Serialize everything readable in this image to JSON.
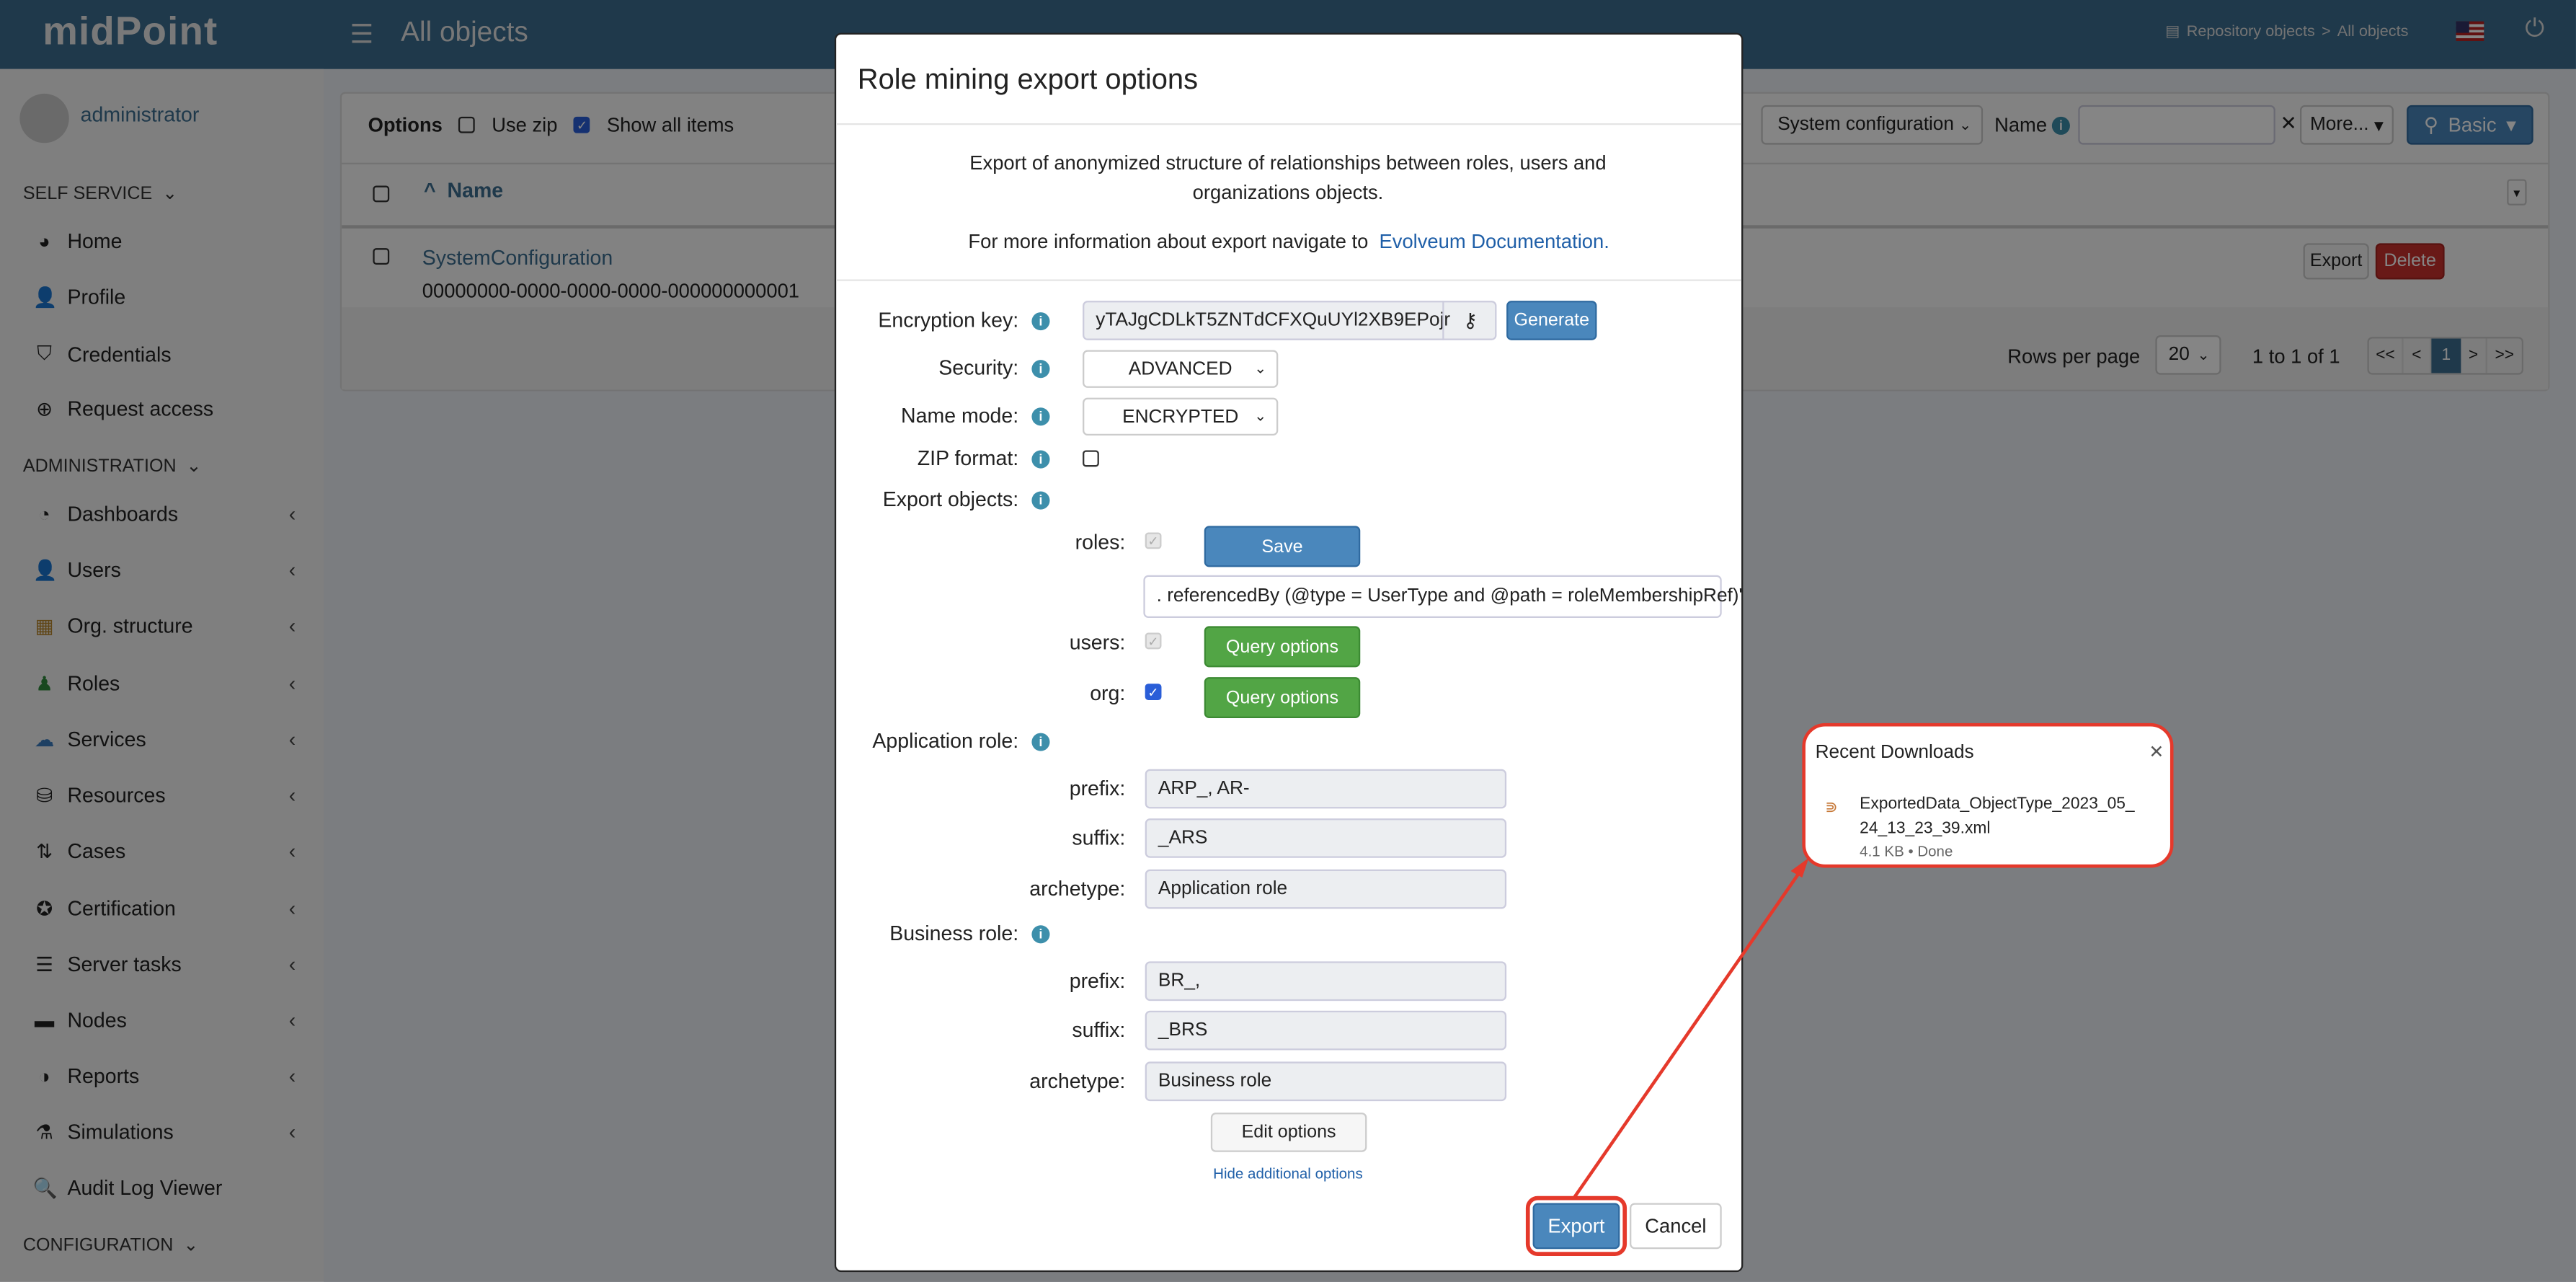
{
  "header": {
    "logo": "midPoint",
    "title": "All objects",
    "breadcrumb": [
      "Repository objects",
      ">",
      "All objects"
    ]
  },
  "sidebar": {
    "user": "administrator",
    "sections": [
      {
        "label": "SELF SERVICE",
        "items": [
          "Home",
          "Profile",
          "Credentials",
          "Request access"
        ]
      },
      {
        "label": "ADMINISTRATION",
        "items": [
          "Dashboards",
          "Users",
          "Org. structure",
          "Roles",
          "Services",
          "Resources",
          "Cases",
          "Certification",
          "Server tasks",
          "Nodes",
          "Reports",
          "Simulations",
          "Audit Log Viewer"
        ]
      },
      {
        "label": "CONFIGURATION",
        "items": []
      }
    ]
  },
  "main": {
    "options_label": "Options",
    "use_zip": "Use zip",
    "show_all": "Show all items",
    "type_select": "System configuration",
    "name_label": "Name",
    "name_value": "",
    "more": "More...",
    "basic": "Basic",
    "column_name": "Name",
    "row": {
      "name": "SystemConfiguration",
      "oid": "00000000-0000-0000-0000-000000000001",
      "export": "Export",
      "delete": "Delete"
    },
    "rows_per_page_label": "Rows per page",
    "rows_per_page": "20",
    "range": "1 to 1 of 1",
    "pager": [
      "<<",
      "<",
      "1",
      ">",
      ">>"
    ]
  },
  "modal": {
    "title": "Role mining export options",
    "description": "Export of anonymized structure of relationships between roles, users and organizations objects.",
    "more_info": "For more information about export navigate to",
    "doc_link": "Evolveum Documentation.",
    "encryption_key_label": "Encryption key:",
    "encryption_key": "yTAJgCDLkT5ZNTdCFXQuUYl2XB9EPojr",
    "generate": "Generate",
    "security_label": "Security:",
    "security": "ADVANCED",
    "name_mode_label": "Name mode:",
    "name_mode": "ENCRYPTED",
    "zip_label": "ZIP format:",
    "export_objects_label": "Export objects:",
    "roles_label": "roles:",
    "save": "Save",
    "query": ". referencedBy (@type = UserType and @path = roleMembershipRef)'",
    "users_label": "users:",
    "org_label": "org:",
    "query_options": "Query options",
    "app_role_label": "Application role:",
    "prefix_label": "prefix:",
    "suffix_label": "suffix:",
    "archetype_label": "archetype:",
    "app_prefix": "ARP_, AR-",
    "app_suffix": "_ARS",
    "app_archetype": "Application role",
    "bus_role_label": "Business role:",
    "bus_prefix": "BR_,",
    "bus_suffix": "_BRS",
    "bus_archetype": "Business role",
    "edit_options": "Edit options",
    "hide_options": "Hide additional options",
    "export": "Export",
    "cancel": "Cancel"
  },
  "downloads": {
    "title": "Recent Downloads",
    "file": "ExportedData_ObjectType_2023_05_24_13_23_39.xml",
    "status": "4.1 KB • Done"
  },
  "colors": {
    "header": "#3c6e91",
    "primary": "#4a87bc",
    "success": "#52a545",
    "danger": "#c9302c",
    "annotation": "#e5392b"
  }
}
